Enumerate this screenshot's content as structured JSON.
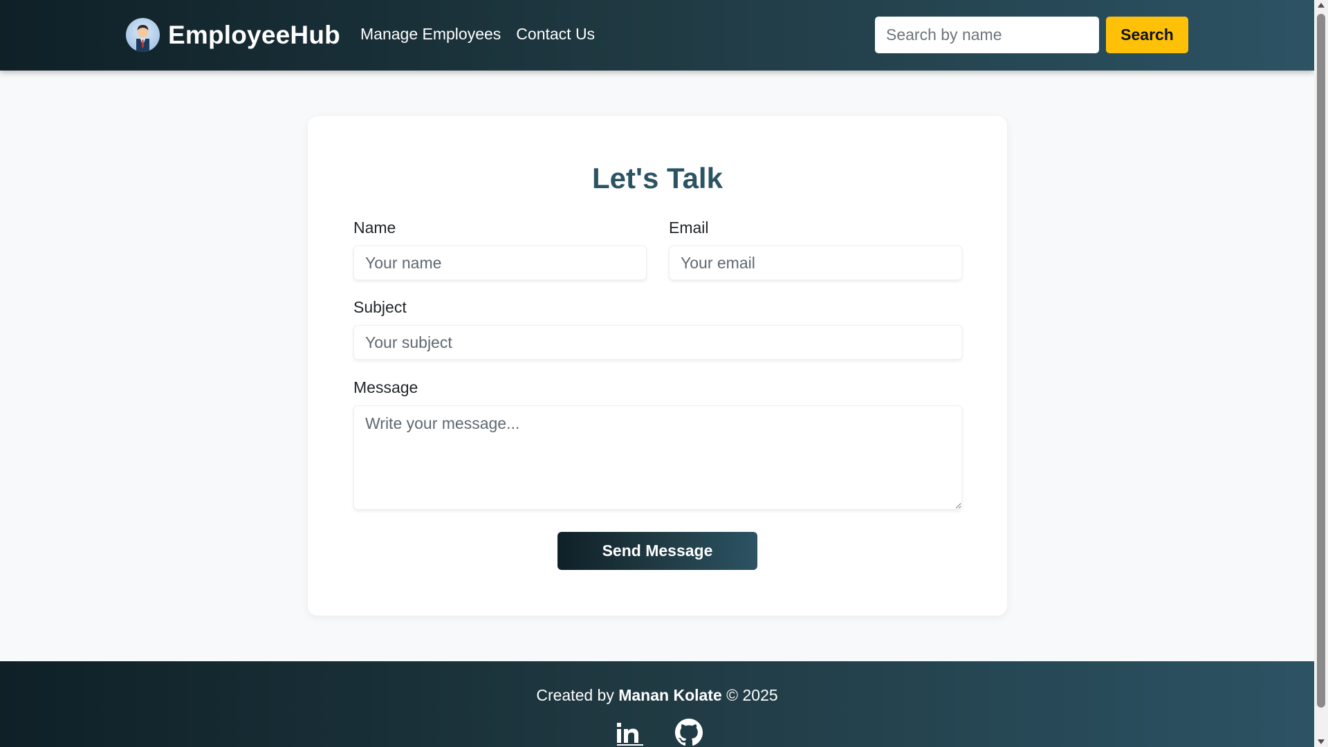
{
  "header": {
    "brand": "EmployeeHub",
    "logo_icon": "employee-avatar-icon",
    "nav": [
      {
        "label": "Manage Employees"
      },
      {
        "label": "Contact Us"
      }
    ],
    "search": {
      "placeholder": "Search by name",
      "value": ""
    },
    "search_button": "Search"
  },
  "form": {
    "title": "Let's Talk",
    "name": {
      "label": "Name",
      "placeholder": "Your name"
    },
    "email": {
      "label": "Email",
      "placeholder": "Your email"
    },
    "subject": {
      "label": "Subject",
      "placeholder": "Your subject"
    },
    "message": {
      "label": "Message",
      "placeholder": "Write your message..."
    },
    "submit": "Send Message"
  },
  "footer": {
    "created_by": "Created by",
    "author": "Manan Kolate",
    "copyright": "© 2025",
    "social": [
      {
        "icon": "linkedin-icon"
      },
      {
        "icon": "github-icon"
      }
    ]
  },
  "colors": {
    "gradient_start": "#0f2027",
    "gradient_mid": "#203a43",
    "gradient_end": "#2c5364",
    "accent": "#ffc107",
    "title": "#2c5364",
    "background": "#f8f9fa"
  }
}
